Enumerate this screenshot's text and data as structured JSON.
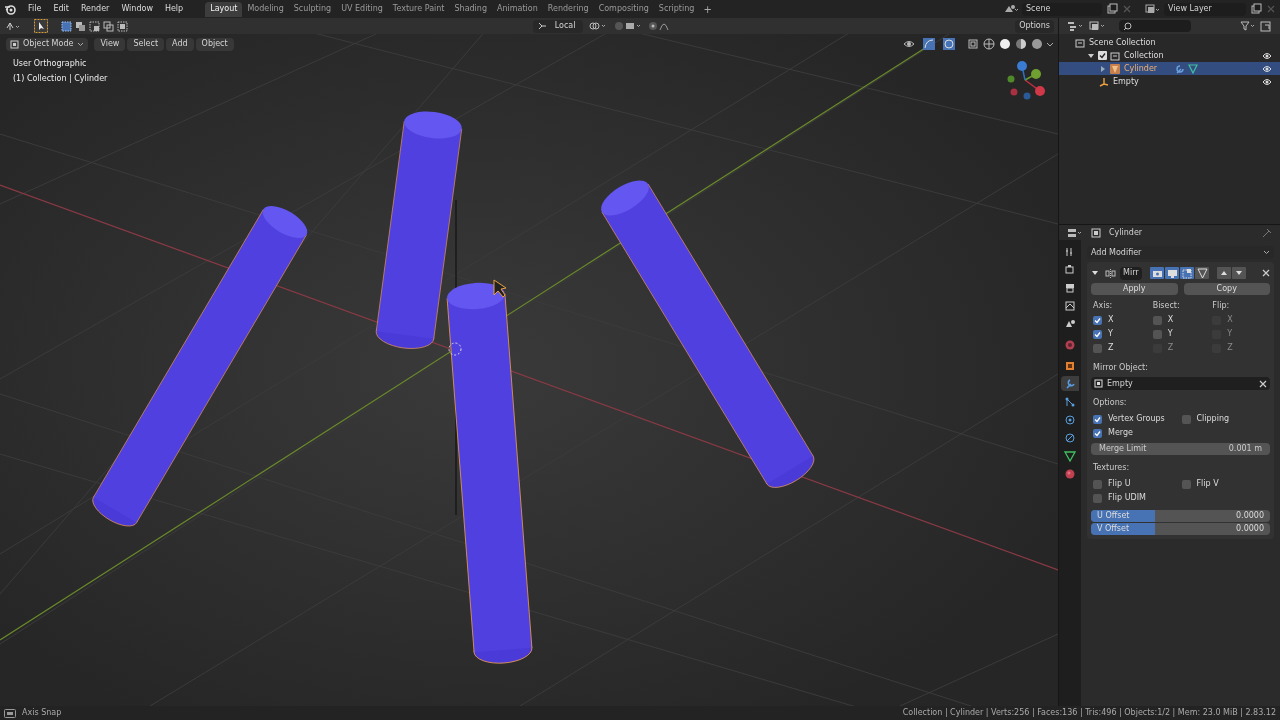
{
  "menus": [
    "File",
    "Edit",
    "Render",
    "Window",
    "Help"
  ],
  "workspaces": [
    {
      "label": "Layout",
      "selected": true
    },
    {
      "label": "Modeling",
      "selected": false
    },
    {
      "label": "Sculpting",
      "selected": false
    },
    {
      "label": "UV Editing",
      "selected": false
    },
    {
      "label": "Texture Paint",
      "selected": false
    },
    {
      "label": "Shading",
      "selected": false
    },
    {
      "label": "Animation",
      "selected": false
    },
    {
      "label": "Rendering",
      "selected": false
    },
    {
      "label": "Compositing",
      "selected": false
    },
    {
      "label": "Scripting",
      "selected": false
    }
  ],
  "add_workspace": "+",
  "scene": "Scene",
  "view_layer": "View Layer",
  "tool_header": {
    "orientation": "Local",
    "options": "Options"
  },
  "viewport": {
    "mode": "Object Mode",
    "menus": [
      "View",
      "Select",
      "Add",
      "Object"
    ],
    "info": [
      "User Orthographic",
      "(1) Collection | Cylinder"
    ]
  },
  "outliner": {
    "items": [
      {
        "label": "Scene Collection",
        "kind": "scene_collection",
        "selected": false,
        "children": [
          {
            "label": "Collection",
            "kind": "collection",
            "selected": false,
            "checked": true,
            "expanded": true,
            "visible": true,
            "children": [
              {
                "label": "Cylinder",
                "kind": "mesh",
                "selected": true,
                "expanded": false,
                "visible": true
              },
              {
                "label": "Empty",
                "kind": "empty",
                "selected": false,
                "visible": true
              }
            ]
          }
        ]
      }
    ]
  },
  "properties": {
    "tabs": [
      {
        "selected": false
      },
      {
        "selected": false
      },
      {
        "selected": false
      },
      {
        "selected": false
      },
      {
        "selected": false
      },
      {
        "selected": false
      },
      {
        "selected": false
      },
      {
        "selected": true
      },
      {
        "selected": false
      },
      {
        "selected": false
      },
      {
        "selected": false
      },
      {
        "selected": false
      },
      {
        "selected": false
      }
    ],
    "object_name": "Cylinder",
    "add_modifier": "Add Modifier",
    "modifier": {
      "expanded": true,
      "name": "Mirr",
      "buttons": [
        "Apply",
        "Copy"
      ],
      "axis_columns": [
        {
          "header": "Axis:",
          "items": [
            {
              "label": "X",
              "checked": true,
              "disabled": false
            },
            {
              "label": "Y",
              "checked": true,
              "disabled": false
            },
            {
              "label": "Z",
              "checked": false,
              "disabled": false
            }
          ]
        },
        {
          "header": "Bisect:",
          "items": [
            {
              "label": "X",
              "checked": false,
              "disabled": false
            },
            {
              "label": "Y",
              "checked": false,
              "disabled": false
            },
            {
              "label": "Z",
              "checked": false,
              "disabled": true
            }
          ]
        },
        {
          "header": "Flip:",
          "items": [
            {
              "label": "X",
              "checked": false,
              "disabled": true
            },
            {
              "label": "Y",
              "checked": false,
              "disabled": true
            },
            {
              "label": "Z",
              "checked": false,
              "disabled": true
            }
          ]
        }
      ],
      "mirror_object_label": "Mirror Object:",
      "mirror_object": "Empty",
      "options_label": "Options:",
      "options": [
        {
          "label": "Vertex Groups",
          "checked": true
        },
        {
          "label": "Clipping",
          "checked": false
        },
        {
          "label": "Merge",
          "checked": true
        }
      ],
      "merge_limit": {
        "label": "Merge Limit",
        "value": "0.001 m"
      },
      "textures_label": "Textures:",
      "textures": [
        {
          "label": "Flip U",
          "checked": false
        },
        {
          "label": "Flip V",
          "checked": false
        },
        {
          "label": "Flip UDIM",
          "checked": false
        }
      ],
      "offsets": [
        {
          "label": "U Offset",
          "value": "0.0000",
          "level": 0.36
        },
        {
          "label": "V Offset",
          "value": "0.0000",
          "level": 0.36
        }
      ]
    }
  },
  "status_bar": {
    "left": "Axis Snap",
    "right": "Collection | Cylinder | Verts:256 | Faces:136 | Tris:496 | Objects:1/2 | Mem: 23.0 MiB | 2.83.12"
  }
}
